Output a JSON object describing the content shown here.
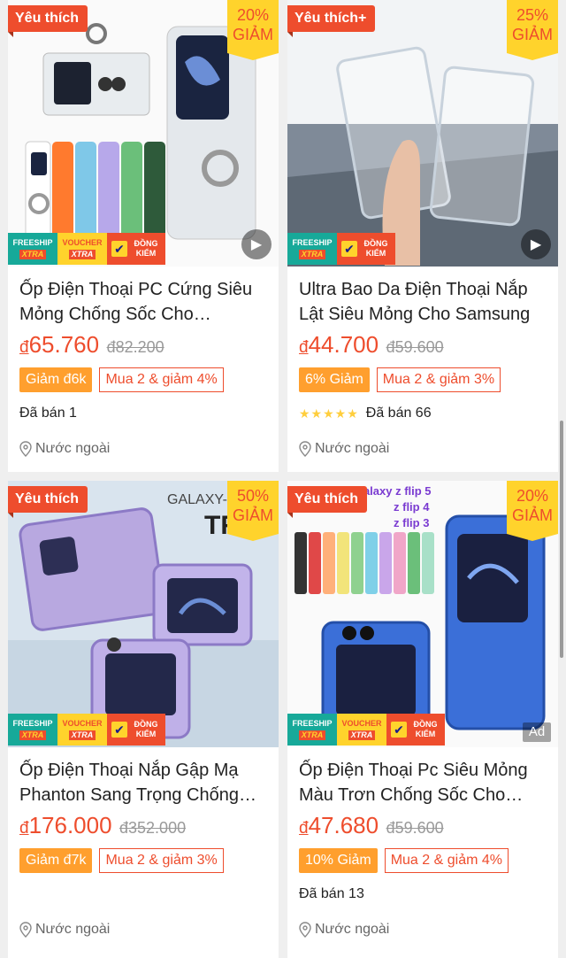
{
  "products": [
    {
      "fav_label": "Yêu thích",
      "discount_pct": "20%",
      "discount_word": "GIẢM",
      "badges": {
        "free1": "FREESHIP",
        "free2": "XTRA",
        "v1": "VOUCHER",
        "v2": "XTRA",
        "check": "ĐỒNG KIỂM"
      },
      "has_play": true,
      "has_ad": false,
      "title": "Ốp Điện Thoại PC Cứng Siêu Mỏng Chống Sốc Cho Samsung",
      "currency": "đ",
      "price": "65.760",
      "old_price": "đ82.200",
      "promo_discount": "Giảm đ6k",
      "promo_buy": "Mua 2 & giảm 4%",
      "stars": "",
      "sold": "Đã bán 1",
      "location": "Nước ngoài"
    },
    {
      "fav_label": "Yêu thích+",
      "discount_pct": "25%",
      "discount_word": "GIẢM",
      "badges": {
        "free1": "FREESHIP",
        "free2": "XTRA",
        "v1": "",
        "v2": "",
        "check": "ĐỒNG KIỂM"
      },
      "has_play": true,
      "has_ad": false,
      "title": "Ultra Bao Da Điện Thoại Nắp Lật Siêu Mỏng Cho Samsung",
      "currency": "đ",
      "price": "44.700",
      "old_price": "đ59.600",
      "promo_discount": "6% Giảm",
      "promo_buy": "Mua 2 & giảm 3%",
      "stars": "★★★★★",
      "sold": "Đã bán 66",
      "location": "Nước ngoài"
    },
    {
      "fav_label": "Yêu thích",
      "discount_pct": "50%",
      "discount_word": "GIẢM",
      "badges": {
        "free1": "FREESHIP",
        "free2": "XTRA",
        "v1": "VOUCHER",
        "v2": "XTRA",
        "check": "ĐỒNG KIỂM"
      },
      "has_play": false,
      "has_ad": false,
      "title": "Ốp Điện Thoại Nắp Gập Mạ Phanton Sang Trọng Chống Sốc",
      "currency": "đ",
      "price": "176.000",
      "old_price": "đ352.000",
      "promo_discount": "Giảm đ7k",
      "promo_buy": "Mua 2 & giảm 3%",
      "stars": "",
      "sold": "",
      "location": "Nước ngoài"
    },
    {
      "fav_label": "Yêu thích",
      "discount_pct": "20%",
      "discount_word": "GIẢM",
      "badges": {
        "free1": "FREESHIP",
        "free2": "XTRA",
        "v1": "VOUCHER",
        "v2": "XTRA",
        "check": "ĐỒNG KIỂM"
      },
      "has_play": false,
      "has_ad": true,
      "ad_label": "Ad",
      "title": "Ốp Điện Thoại Pc Siêu Mỏng Màu Trơn Chống Sốc Cho Samsung",
      "currency": "đ",
      "price": "47.680",
      "old_price": "đ59.600",
      "promo_discount": "10% Giảm",
      "promo_buy": "Mua 2 & giảm 4%",
      "stars": "",
      "sold": "Đã bán 13",
      "location": "Nước ngoài"
    }
  ],
  "image_texts": {
    "p3_brand": "GALAXY-Z",
    "p3_brand2": "TR",
    "p4_l1": "galaxy z flip 5",
    "p4_l2": "z flip 4",
    "p4_l3": "z flip 3"
  },
  "colors": {
    "accent": "#ee4d2d",
    "discount_bg": "#ffd32c",
    "promo_orange": "#ff9f2e",
    "freeship_teal": "#17a999"
  }
}
